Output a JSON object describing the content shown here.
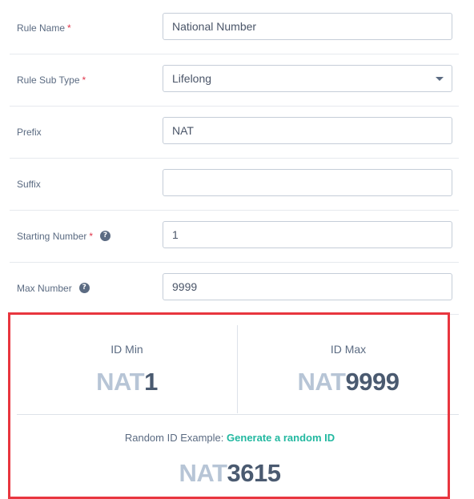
{
  "form": {
    "rule_name": {
      "label": "Rule Name",
      "required": "*",
      "value": "National Number"
    },
    "rule_sub_type": {
      "label": "Rule Sub Type",
      "required": "*",
      "value": "Lifelong"
    },
    "prefix": {
      "label": "Prefix",
      "value": "NAT"
    },
    "suffix": {
      "label": "Suffix",
      "value": ""
    },
    "starting_number": {
      "label": "Starting Number",
      "required": "*",
      "value": "1"
    },
    "max_number": {
      "label": "Max Number",
      "value": "9999"
    }
  },
  "icons": {
    "help": "question-circle-icon",
    "dropdown": "caret-down-icon"
  },
  "preview": {
    "id_min": {
      "title": "ID Min",
      "prefix": "NAT",
      "number": "1"
    },
    "id_max": {
      "title": "ID Max",
      "prefix": "NAT",
      "number": "9999"
    },
    "random": {
      "label": "Random ID Example:",
      "link": "Generate a random ID",
      "prefix": "NAT",
      "number": "3615"
    }
  },
  "colors": {
    "required": "#e0354a",
    "link": "#22b8a0",
    "highlight_border": "#e8363f",
    "prefix": "#b7c5d6",
    "number": "#4a5a70"
  }
}
